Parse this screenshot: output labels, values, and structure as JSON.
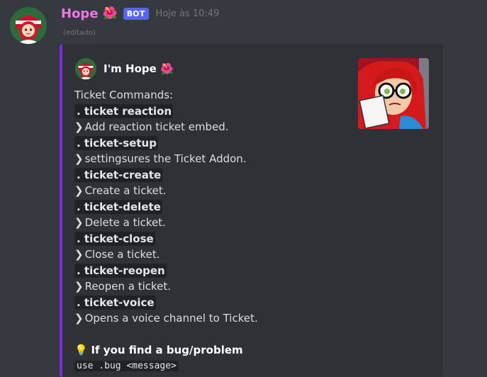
{
  "message": {
    "username": "Hope",
    "name_emoji": "🌺",
    "bot_tag": "BOT",
    "timestamp": "Hoje às 10:49",
    "edited": "(editado)"
  },
  "embed": {
    "accent_color": "#7c2be0",
    "author": "I'm Hope 🌺",
    "title_line": "Ticket Commands:",
    "commands": [
      {
        "command": ". ticket reaction",
        "desc": "Add reaction ticket embed."
      },
      {
        "command": ". ticket-setup",
        "desc": "settingsures the Ticket Addon."
      },
      {
        "command": ". ticket-create",
        "desc": "Create a ticket."
      },
      {
        "command": ". ticket-delete",
        "desc": "Delete a ticket."
      },
      {
        "command": ". ticket-close",
        "desc": "Close a ticket."
      },
      {
        "command": ". ticket-reopen",
        "desc": "Reopen a ticket."
      },
      {
        "command": ". ticket-voice",
        "desc": "Opens a voice channel to Ticket."
      }
    ],
    "arrow_glyph": "❯",
    "bug_icon": "light-bulb-icon",
    "bug_emoji": "💡",
    "bug_title": "If you find a bug/problem",
    "bug_usage": "use .bug <message>"
  }
}
